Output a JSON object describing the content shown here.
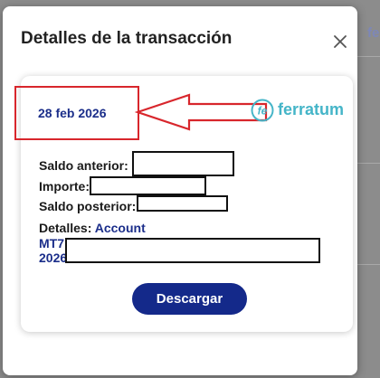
{
  "background": {
    "partial_text": "fe"
  },
  "modal": {
    "title": "Detalles de la transacción",
    "close_icon": "close-icon"
  },
  "card": {
    "date": "28 feb 2026",
    "logo": {
      "icon": "ferratum-logo-icon",
      "mark": "fe",
      "text": "ferratum"
    },
    "fields": {
      "saldo_anterior_label": "Saldo anterior:",
      "importe_label": "Importe:",
      "saldo_posterior_label": "Saldo posterior:",
      "detalles_label": "Detalles:",
      "detalles_value": "Account",
      "ref_line_1": "MT7",
      "ref_line_2": "2026"
    },
    "download_label": "Descargar"
  },
  "colors": {
    "accent": "#14298a",
    "date_text": "#1b2e8a",
    "annotation_red": "#d8262c",
    "logo_teal": "#45b5c8"
  }
}
